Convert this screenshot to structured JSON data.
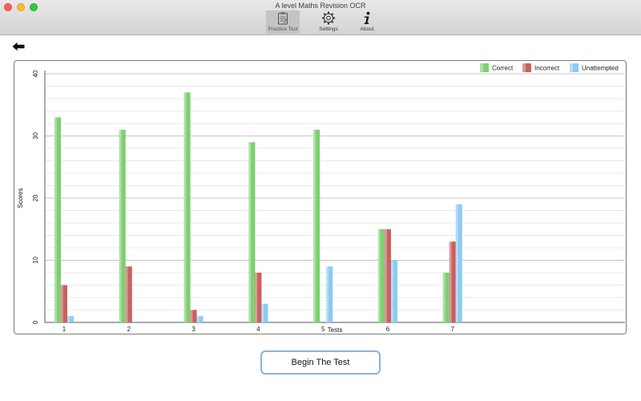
{
  "window": {
    "title": "A level Maths Revision OCR"
  },
  "toolbar": {
    "items": [
      {
        "label": "Practice Test",
        "icon": "clipboard-icon",
        "active": true
      },
      {
        "label": "Settings",
        "icon": "gear-icon",
        "active": false
      },
      {
        "label": "About",
        "icon": "info-icon",
        "active": false
      }
    ]
  },
  "back": {
    "icon": "back-arrow-icon"
  },
  "chart_data": {
    "type": "bar",
    "xlabel": "Tests",
    "ylabel": "Scores",
    "ylim": [
      0,
      40
    ],
    "yticks": [
      0,
      10,
      20,
      30,
      40
    ],
    "grid": true,
    "legend_position": "top-right",
    "categories": [
      "1",
      "2",
      "3",
      "4",
      "5",
      "6",
      "7"
    ],
    "series": [
      {
        "name": "Correct",
        "color": "#7fcf73",
        "values": [
          33,
          31,
          37,
          29,
          31,
          15,
          8
        ]
      },
      {
        "name": "Incorrect",
        "color": "#c96060",
        "values": [
          6,
          9,
          2,
          8,
          0,
          15,
          13
        ]
      },
      {
        "name": "Unattempted",
        "color": "#8ccaf2",
        "values": [
          1,
          0,
          1,
          3,
          9,
          10,
          19
        ]
      }
    ]
  },
  "actions": {
    "begin_label": "Begin The Test"
  }
}
